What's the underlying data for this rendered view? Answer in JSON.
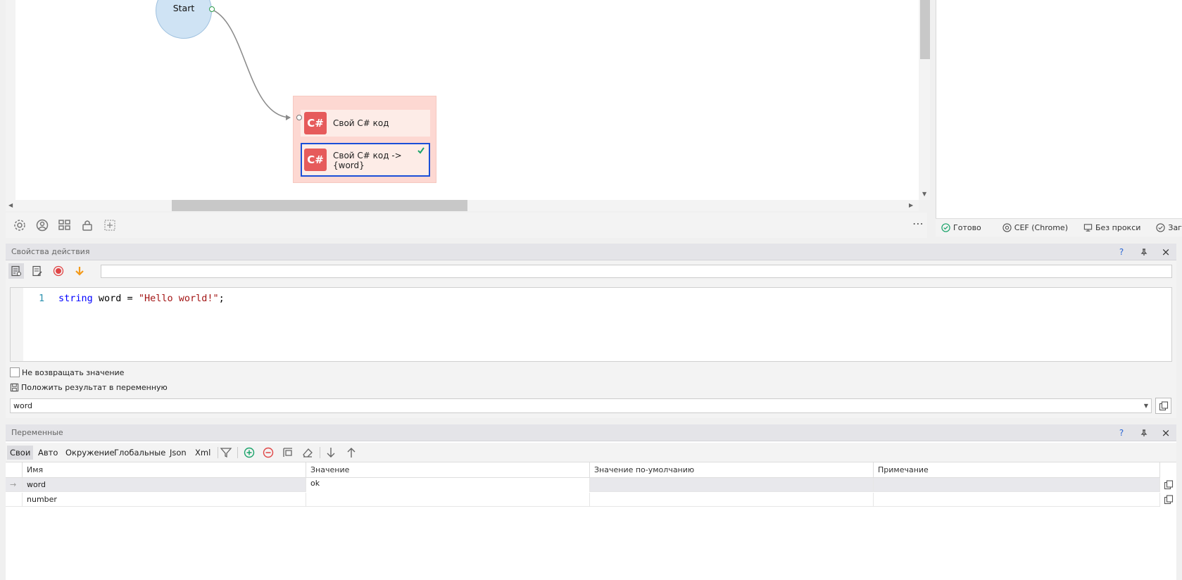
{
  "canvas": {
    "start_label": "Start",
    "actions": [
      {
        "badge": "C#",
        "label": "Свой C# код"
      },
      {
        "badge": "C#",
        "label_line1": "Свой C# код ->",
        "label_line2": "{word}"
      }
    ]
  },
  "status_bar": {
    "items": [
      "Готово",
      "CEF (Chrome)",
      "Без прокси",
      "Загружа"
    ]
  },
  "properties_panel": {
    "title": "Свойства действия",
    "help": "?",
    "code": {
      "line_number": "1",
      "keyword": "string",
      "statement": " word = ",
      "string_literal": "\"Hello world!\"",
      "terminator": ";"
    },
    "no_return_label": "Не возвращать значение",
    "save_result_label": "Положить результат в переменную",
    "result_variable": "word"
  },
  "variables_panel": {
    "title": "Переменные",
    "help": "?",
    "tabs": [
      "Свои",
      "Авто",
      "Окружение",
      "Глобальные",
      "Json",
      "Xml"
    ],
    "active_tab": "Свои",
    "columns": [
      "Имя",
      "Значение",
      "Значение по-умолчанию",
      "Примечание"
    ],
    "rows": [
      {
        "name": "word",
        "value": "ok",
        "default": "",
        "note": ""
      },
      {
        "name": "number",
        "value": "",
        "default": "",
        "note": ""
      }
    ]
  },
  "colors": {
    "accent_blue": "#1a4fd8",
    "csharp_badge": "#e65b5b",
    "start_node": "#cfe3f4",
    "group_bg": "#fdd8d2",
    "success_green": "#1aa36a"
  }
}
